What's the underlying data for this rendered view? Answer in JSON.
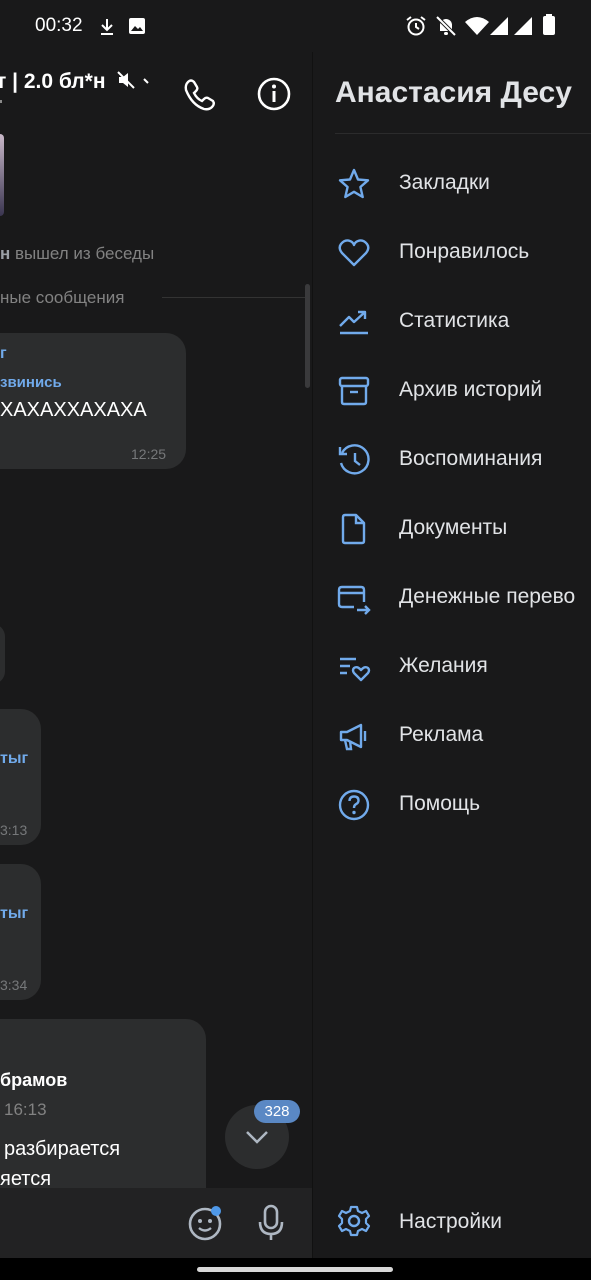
{
  "status_bar": {
    "time": "00:32",
    "icons": [
      "download-icon",
      "image-icon",
      "alarm-icon",
      "mute-notifications-icon",
      "wifi-icon",
      "signal-icon",
      "signal-icon",
      "battery-icon"
    ]
  },
  "chat": {
    "title": "т | 2.0 бл*н",
    "system_message": {
      "actor": "н",
      "text": " вышел из беседы"
    },
    "unread_separator": "ные сообщения",
    "messages": [
      {
        "author": "г",
        "reply_author": "звинись",
        "text": "ХАХАХХАХАХА",
        "time": "12:25"
      },
      {
        "author": "тыг",
        "time": "3:13"
      },
      {
        "author": "тыг",
        "time": "3:34"
      },
      {
        "name": "брамов",
        "time": "16:13",
        "line1": "разбирается",
        "line2": "яется"
      }
    ],
    "unread_count": "328"
  },
  "drawer": {
    "user_name": "Анастасия Десу",
    "accent_color": "#71aaeb",
    "items": [
      {
        "icon": "star-icon",
        "label": "Закладки"
      },
      {
        "icon": "heart-icon",
        "label": "Понравилось"
      },
      {
        "icon": "statistics-icon",
        "label": "Статистика"
      },
      {
        "icon": "archive-icon",
        "label": "Архив историй"
      },
      {
        "icon": "history-icon",
        "label": "Воспоминания"
      },
      {
        "icon": "document-icon",
        "label": "Документы"
      },
      {
        "icon": "money-transfer-icon",
        "label": "Денежные перево"
      },
      {
        "icon": "wishlist-icon",
        "label": "Желания"
      },
      {
        "icon": "megaphone-icon",
        "label": "Реклама"
      },
      {
        "icon": "help-icon",
        "label": "Помощь"
      }
    ],
    "settings": {
      "icon": "gear-icon",
      "label": "Настройки"
    }
  }
}
